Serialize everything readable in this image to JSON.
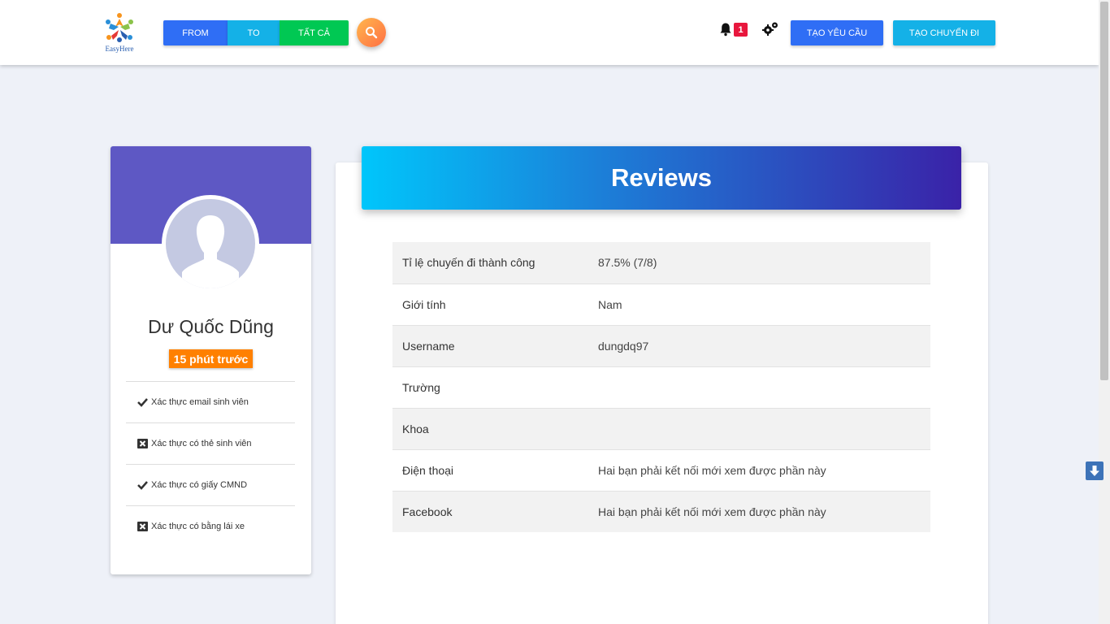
{
  "header": {
    "logo_text": "EasyHere",
    "filters": {
      "from": "FROM",
      "to": "TO",
      "all": "TẤT CẢ"
    },
    "notification_count": "1",
    "create_request": "TẠO YÊU CẦU",
    "create_trip": "TẠO CHUYẾN ĐI"
  },
  "profile": {
    "name": "Dư Quốc Dũng",
    "last_active": "15 phút trước",
    "verifications": [
      {
        "label": "Xác thực email sinh viên",
        "status": "verified"
      },
      {
        "label": "Xác thực có thẻ sinh viên",
        "status": "unverified"
      },
      {
        "label": "Xác thực có giấy CMND",
        "status": "verified"
      },
      {
        "label": "Xác thực có bằng lái xe",
        "status": "unverified"
      }
    ]
  },
  "reviews": {
    "title": "Reviews",
    "rows": [
      {
        "key": "Tỉ lệ chuyến đi thành công",
        "value": "87.5% (7/8)"
      },
      {
        "key": "Giới tính",
        "value": "Nam"
      },
      {
        "key": "Username",
        "value": "dungdq97"
      },
      {
        "key": "Trường",
        "value": ""
      },
      {
        "key": "Khoa",
        "value": ""
      },
      {
        "key": "Điện thoại",
        "value": "Hai bạn phải kết nối mới xem được phần này"
      },
      {
        "key": "Facebook",
        "value": "Hai bạn phải kết nối mới xem được phần này"
      }
    ]
  },
  "colors": {
    "primary_blue": "#2f6ef5",
    "cyan": "#14b1e7",
    "green": "#00c853",
    "orange": "#ff8000",
    "purple": "#5e58c4",
    "badge_red": "#e8173d"
  },
  "icons": {
    "search": "search-icon",
    "bell": "bell-icon",
    "settings": "gears-icon",
    "verified": "check-icon",
    "unverified": "close-box-icon",
    "scroll_down": "arrow-down-icon"
  }
}
